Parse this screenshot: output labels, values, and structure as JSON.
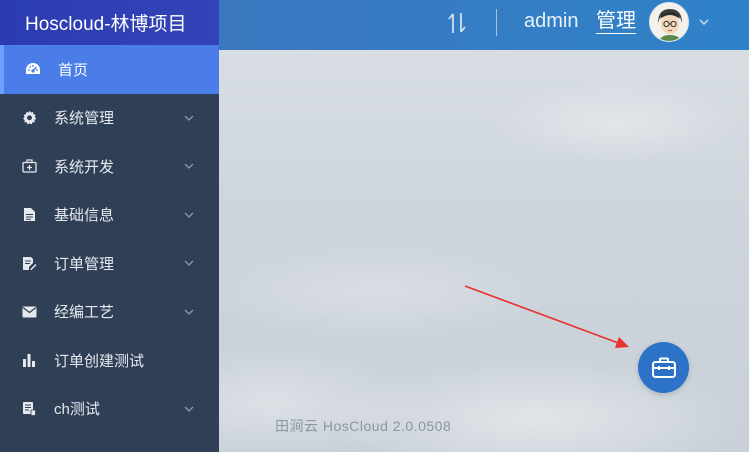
{
  "app": {
    "title": "Hoscloud-林博项目"
  },
  "sidebar": {
    "items": [
      {
        "label": "首页",
        "icon": "dashboard-icon",
        "active": true
      },
      {
        "label": "系统管理",
        "icon": "gear-icon",
        "expandable": true
      },
      {
        "label": "系统开发",
        "icon": "medkit-icon",
        "expandable": true
      },
      {
        "label": "基础信息",
        "icon": "file-icon",
        "expandable": true
      },
      {
        "label": "订单管理",
        "icon": "edit-file-icon",
        "expandable": true
      },
      {
        "label": "经编工艺",
        "icon": "envelope-icon",
        "expandable": true
      },
      {
        "label": "订单创建测试",
        "icon": "bar-chart-icon",
        "expandable": false
      },
      {
        "label": "ch测试",
        "icon": "device-icon",
        "expandable": true
      }
    ]
  },
  "header": {
    "username": "admin",
    "manage_label": "管理"
  },
  "footer": {
    "text": "田涧云 HosCloud 2.0.0508"
  },
  "colors": {
    "sidebar_bg": "#2f4056",
    "brand_bg": "#3543b8",
    "active_item": "#4a7de8",
    "header_bg": "#3b78c0",
    "fab_bg": "#2c73c8",
    "arrow": "#e8322e"
  }
}
